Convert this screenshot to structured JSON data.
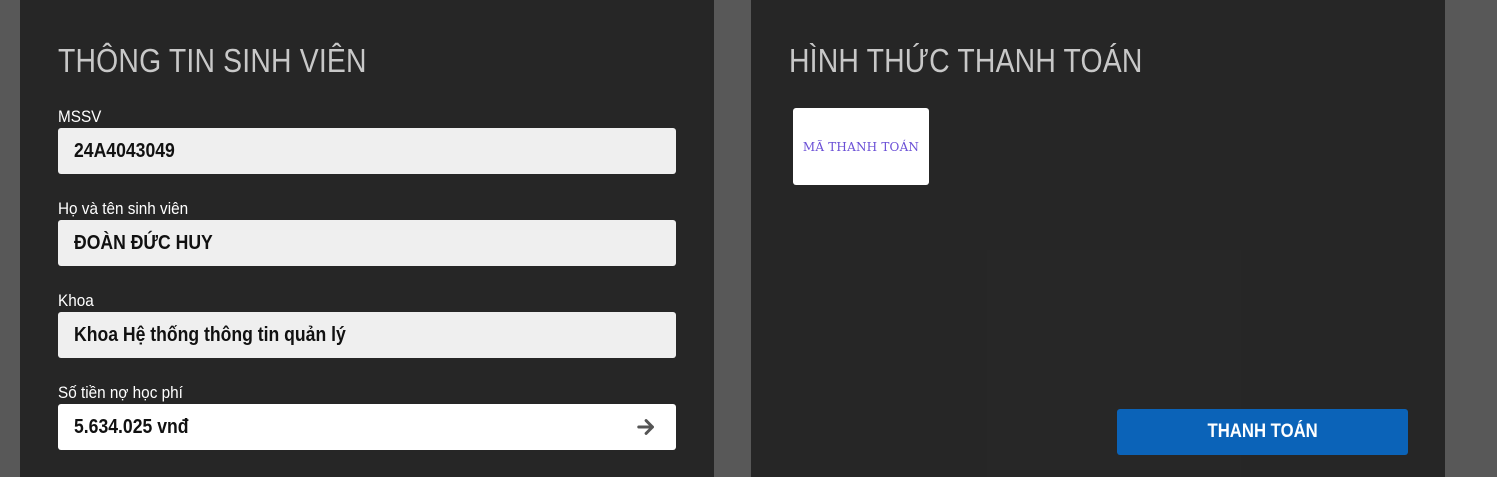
{
  "student_info": {
    "title": "THÔNG TIN SINH VIÊN",
    "fields": [
      {
        "label": "MSSV",
        "value": "24A4043049"
      },
      {
        "label": "Họ và tên sinh viên",
        "value": "ĐOÀN ĐỨC HUY"
      },
      {
        "label": "Khoa",
        "value": "Khoa Hệ thống thông tin quản lý"
      },
      {
        "label": "Số tiền nợ học phí",
        "value": "5.634.025 vnđ"
      }
    ],
    "debt_action_icon": "arrow-right-icon"
  },
  "payment": {
    "title": "HÌNH THỨC THANH TOÁN",
    "methods": [
      {
        "label": "MÃ THANH TOÁN"
      }
    ],
    "submit_label": "THANH TOÁN"
  },
  "colors": {
    "page_background": "#585858",
    "panel_background": "#262626",
    "field_background": "#efefef",
    "primary_button": "#0b63b8",
    "method_text": "#6a4fd6"
  }
}
